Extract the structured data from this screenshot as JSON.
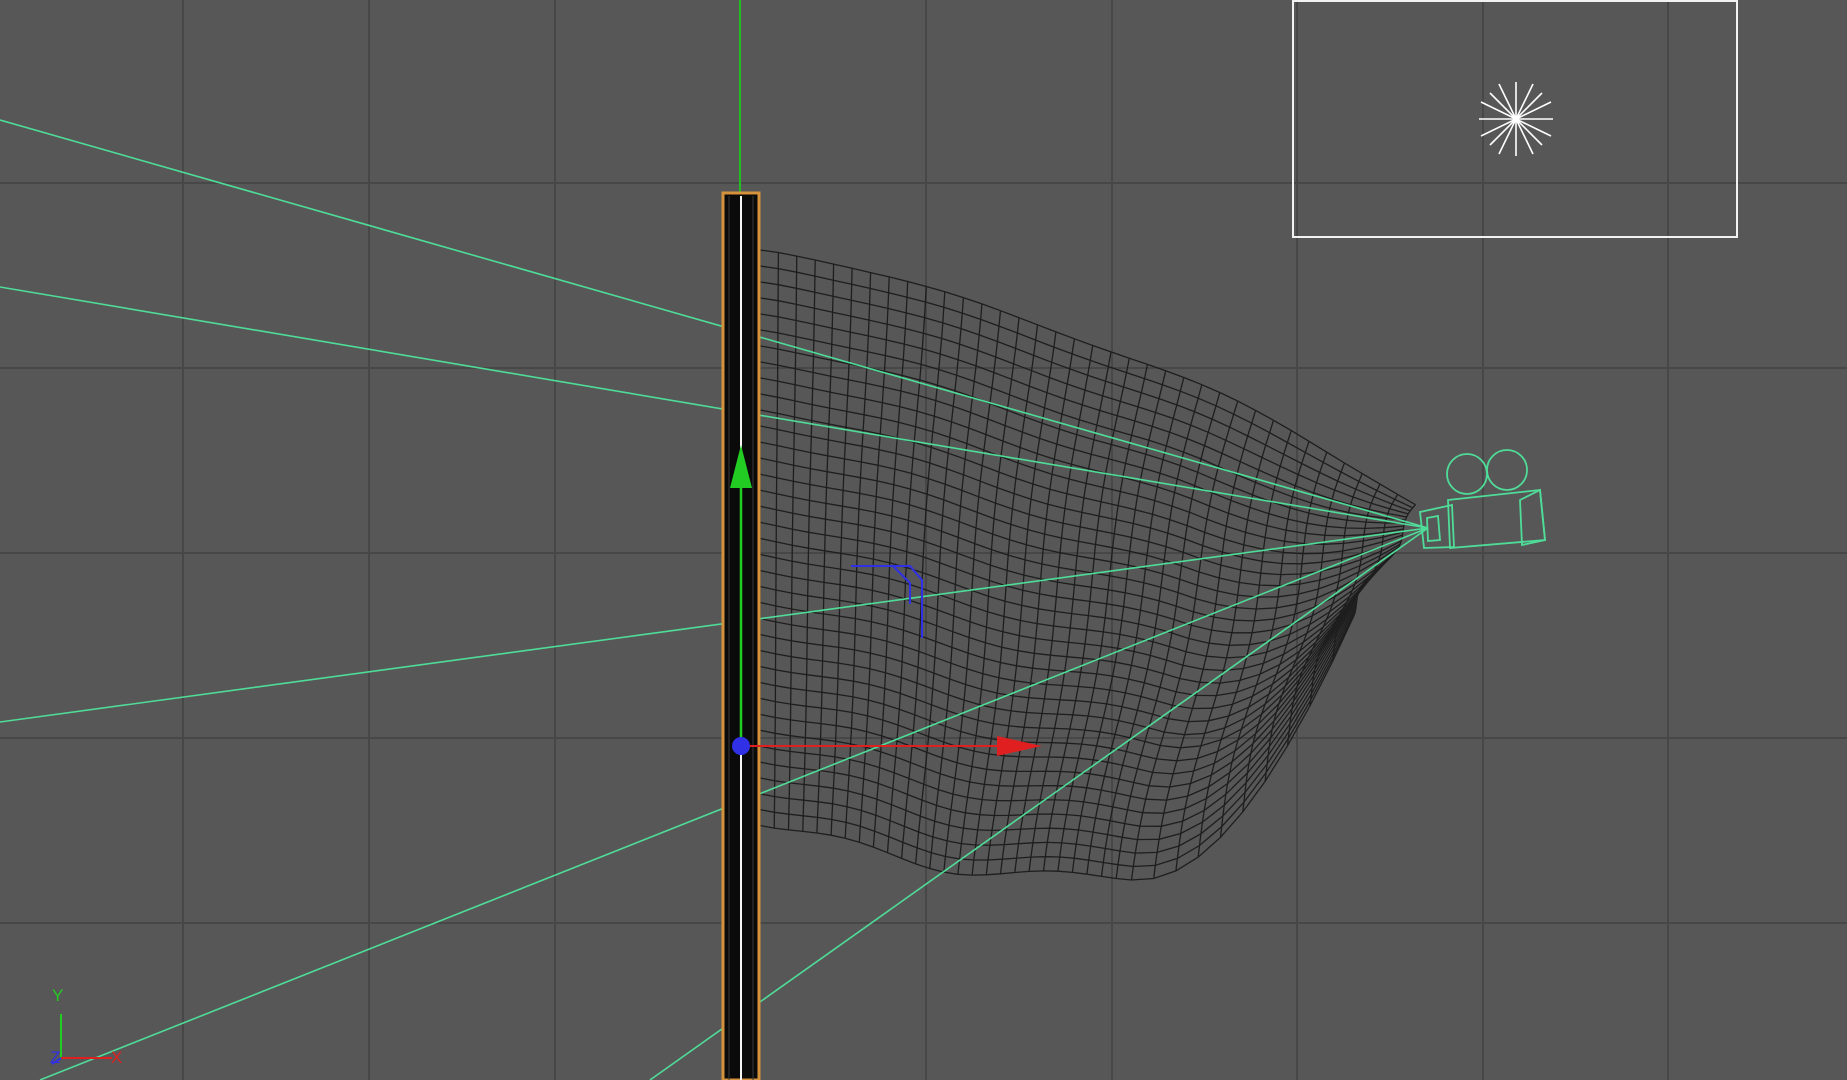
{
  "viewport": {
    "background": "#575757",
    "grid_color": "#474747",
    "wireframe_color": "#1e1e1e",
    "camera_color": "#4fdc98",
    "pole_outline_color": "#d4923c",
    "gizmo": {
      "x_axis_color": "#e02020",
      "y_axis_color": "#22cc22",
      "z_axis_color": "#3030e6"
    },
    "light": {
      "icon": "omni-light-icon",
      "color": "#ffffff"
    }
  },
  "axis_tripod": {
    "y_label": "Y",
    "x_label": "X",
    "z_label": "Z"
  }
}
